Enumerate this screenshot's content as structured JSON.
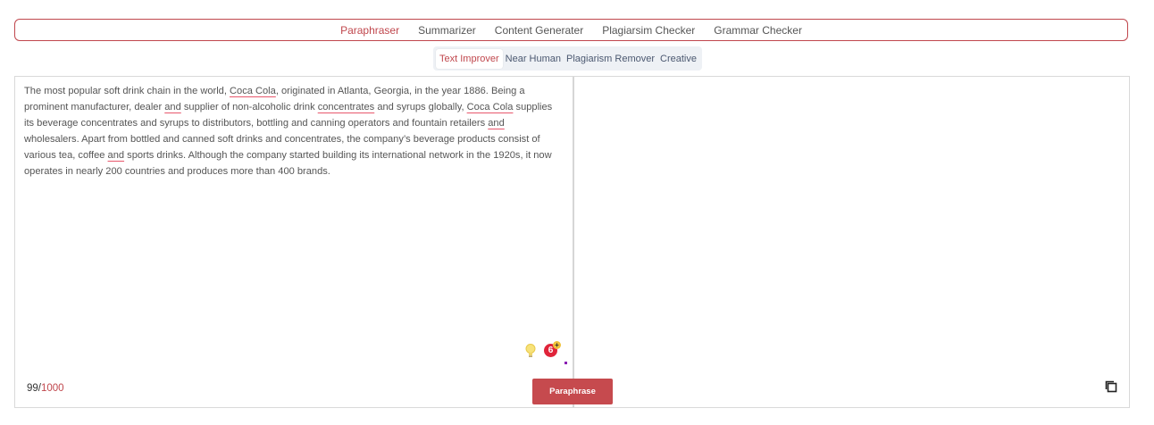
{
  "nav": {
    "items": [
      {
        "label": "Paraphraser",
        "active": true
      },
      {
        "label": "Summarizer",
        "active": false
      },
      {
        "label": "Content Generater",
        "active": false
      },
      {
        "label": "Plagiarsim Checker",
        "active": false
      },
      {
        "label": "Grammar Checker",
        "active": false
      }
    ]
  },
  "modes": {
    "items": [
      {
        "label": "Text Improver",
        "active": true
      },
      {
        "label": "Near Human",
        "active": false
      },
      {
        "label": "Plagiarism Remover",
        "active": false
      },
      {
        "label": "Creative",
        "active": false
      }
    ]
  },
  "editor": {
    "input_segments": [
      {
        "t": "The most popular soft drink chain in the world, ",
        "u": false
      },
      {
        "t": "Coca Cola",
        "u": true
      },
      {
        "t": ", originated in Atlanta, Georgia, in the year 1886. Being a prominent manufacturer, dealer ",
        "u": false
      },
      {
        "t": "and",
        "u": true
      },
      {
        "t": " supplier of non-alcoholic drink ",
        "u": false
      },
      {
        "t": "concentrates",
        "u": true
      },
      {
        "t": " and syrups globally, ",
        "u": false
      },
      {
        "t": "Coca Cola",
        "u": true
      },
      {
        "t": " supplies its beverage concentrates and syrups to distributors, bottling and canning operators and fountain retailers ",
        "u": false
      },
      {
        "t": "and",
        "u": true
      },
      {
        "t": " wholesalers. Apart from bottled and canned soft drinks and concentrates, the company’s beverage products consist of various tea, coffee ",
        "u": false
      },
      {
        "t": "and",
        "u": true
      },
      {
        "t": " sports drinks. Although the company started building its international network in the 1920s, it now operates in nearly 200 countries and produces more than 400 brands.",
        "u": false
      }
    ],
    "word_count": "99",
    "count_separator": "/",
    "word_limit": "1000",
    "grammar_badge_count": "6",
    "grammar_badge_plus": "+",
    "paraphrase_label": "Paraphrase",
    "output_text": ""
  },
  "colors": {
    "accent": "#c0474d",
    "button": "#c64a4e",
    "badge": "#e0243a",
    "underline": "#e8576c"
  },
  "icons": {
    "suggestion": "lightbulb-icon",
    "grammar": "grammar-badge-icon",
    "copy": "copy-icon"
  }
}
